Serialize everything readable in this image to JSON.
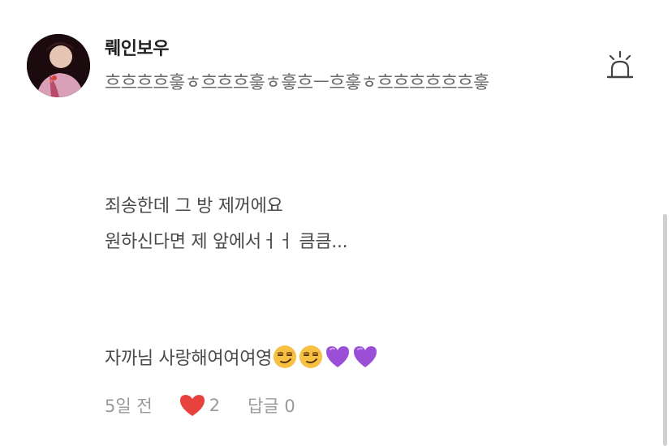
{
  "comment": {
    "author": "뤠인보우",
    "subtitle": "흐흐흐흐흫ㅎ흐흐흐흫ㅎ흫흐ㅡ흐흫ㅎ흐흐흐흐흐흐흫",
    "lines": [
      "죄송한데 그 방 제꺼에요",
      "원하신다면 제 앞에서ㅓㅓ  큼큼..."
    ],
    "last_line_text": "자까님 사랑해여여여영",
    "emojis": [
      "smirking-face-emoji",
      "smirking-face-emoji",
      "purple-heart-emoji",
      "purple-heart-emoji"
    ],
    "time": "5일 전",
    "like_count": "2",
    "reply_label": "답글 0"
  },
  "colors": {
    "heart": "#e8423e",
    "purple_heart": "#9b4fd6",
    "meta_text": "#9a9a9a"
  },
  "icons": {
    "report": "siren-icon",
    "like": "heart-icon"
  }
}
